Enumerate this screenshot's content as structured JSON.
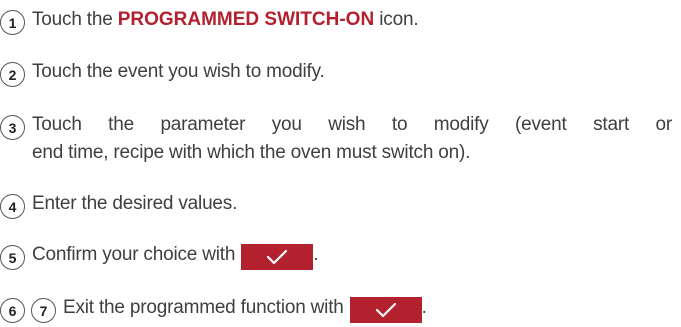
{
  "colors": {
    "accent": "#b3212f",
    "text": "#3f3f3f"
  },
  "steps": [
    {
      "nums": [
        "1"
      ],
      "before": "Touch the",
      "highlight": "PROGRAMMED SWITCH-ON",
      "after": "icon."
    },
    {
      "nums": [
        "2"
      ],
      "text": "Touch the event you wish to modify."
    },
    {
      "nums": [
        "3"
      ],
      "line1": "Touch the parameter you wish to modify (event start or",
      "line2": "end time, recipe with which the oven must switch on)."
    },
    {
      "nums": [
        "4"
      ],
      "text": "Enter the desired values."
    },
    {
      "nums": [
        "5"
      ],
      "text": "Confirm your choice with",
      "button_icon": "check-icon",
      "end": "."
    },
    {
      "nums": [
        "6",
        "7"
      ],
      "text": "Exit the programmed function with",
      "button_icon": "check-icon",
      "end": "."
    }
  ]
}
